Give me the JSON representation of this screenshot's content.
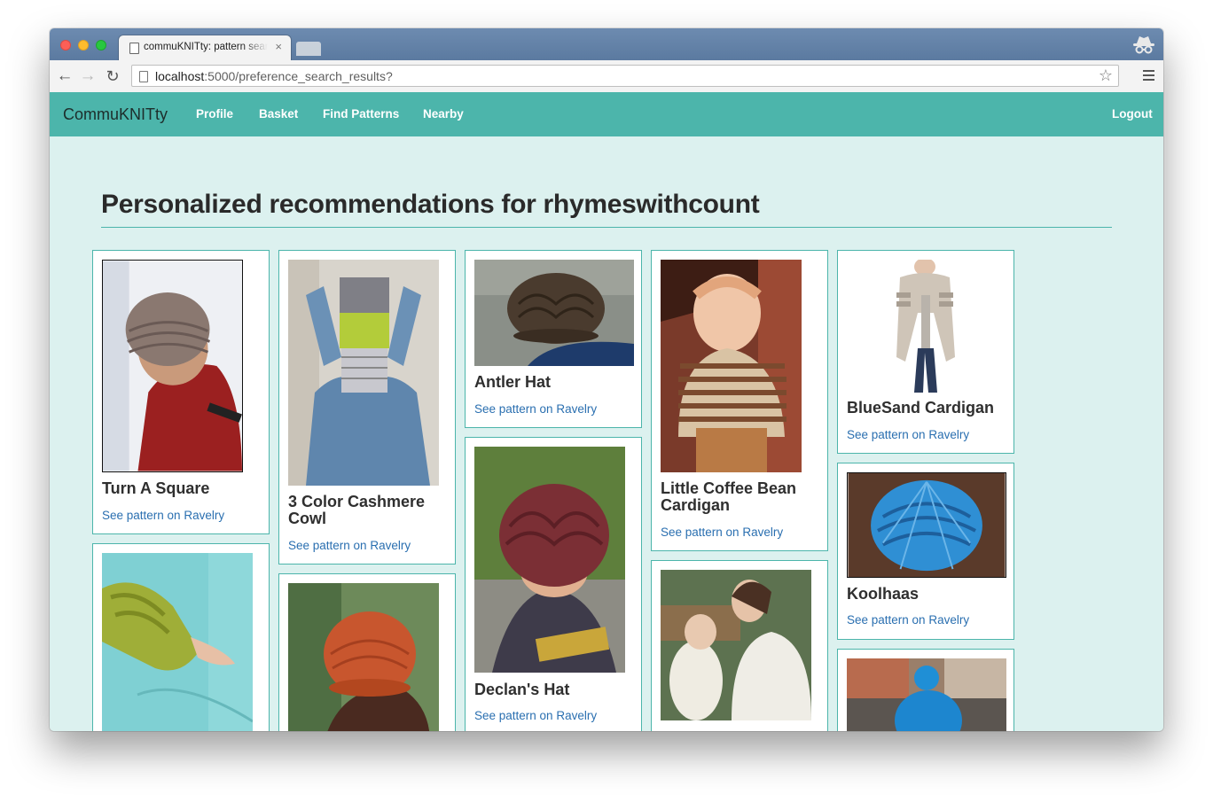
{
  "browser": {
    "tab_title": "commuKNITty: pattern search",
    "tab_close": "×",
    "url_host": "localhost",
    "url_rest": ":5000/preference_search_results?",
    "nav_back": "←",
    "nav_forward": "→",
    "nav_reload": "↻",
    "star": "☆"
  },
  "navbar": {
    "brand": "CommuKNITty",
    "links": [
      "Profile",
      "Basket",
      "Find Patterns",
      "Nearby"
    ],
    "logout": "Logout"
  },
  "heading": "Personalized recommendations for rhymeswithcount",
  "cards": [
    {
      "title": "Turn A Square",
      "link": "See pattern on Ravelry"
    },
    {
      "title": "3 Color Cashmere Cowl",
      "link": "See pattern on Ravelry"
    },
    {
      "title": "Antler Hat",
      "link": "See pattern on Ravelry"
    },
    {
      "title": "Declan's Hat",
      "link": "See pattern on Ravelry"
    },
    {
      "title": "Little Coffee Bean Cardigan",
      "link": "See pattern on Ravelry"
    },
    {
      "title": "BlueSand Cardigan",
      "link": "See pattern on Ravelry"
    },
    {
      "title": "Koolhaas",
      "link": "See pattern on Ravelry"
    }
  ],
  "colors": {
    "accent": "#4cb5ab",
    "page_bg": "#dcf1ef",
    "link": "#2a6fb0"
  }
}
